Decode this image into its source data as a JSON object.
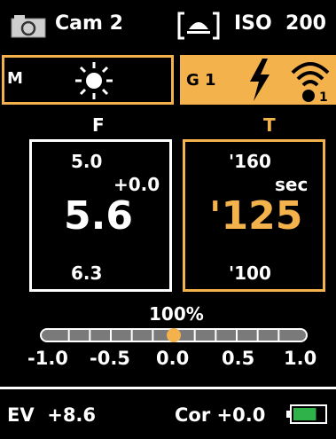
{
  "top_bar": {
    "camera_icon": "camera-icon",
    "camera_label": "Cam 2",
    "mode_icon": "bracket-flash-icon",
    "iso_label": "ISO  200"
  },
  "mode_row": {
    "mode_letter": "M",
    "light_icon": "sun-icon",
    "group_label": "G 1",
    "flash_icon": "lightning-bolt-icon",
    "wireless_icon": "wireless-icon",
    "wireless_channel": "1"
  },
  "aperture": {
    "header": "F",
    "upper": "5.0",
    "compensation": "+0.0",
    "value": "5.6",
    "lower": "6.3"
  },
  "shutter": {
    "header": "T",
    "upper": "'160",
    "unit": "sec",
    "value": "'125",
    "lower": "'100"
  },
  "power": {
    "label": "100%",
    "value": 0.0,
    "ticks": [
      "-1.0",
      "-0.5",
      "0.0",
      "0.5",
      "1.0"
    ]
  },
  "status": {
    "ev_label": "EV  +8.6",
    "cor_label": "Cor +0.0",
    "battery_icon": "battery-icon",
    "battery_level": 0.75
  },
  "colors": {
    "accent": "#f4b24c",
    "battery_fill": "#2fb24a"
  }
}
